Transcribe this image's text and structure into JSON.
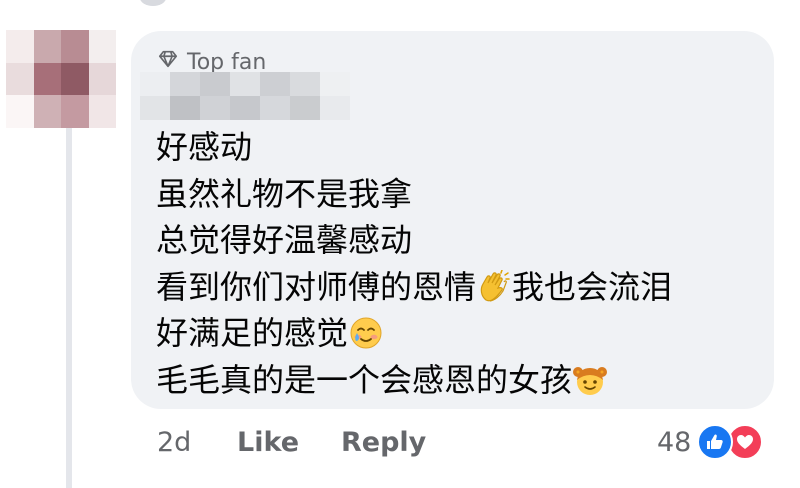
{
  "comment": {
    "badge_label": "Top fan",
    "badge_icon": "diamond-icon",
    "lines": [
      "好感动",
      "虽然礼物不是我拿",
      "总觉得好温馨感动",
      "看到你们对师傅的恩情",
      "我也会流泪",
      "好满足的感觉",
      "毛毛真的是一个会感恩的女孩"
    ],
    "emojis": [
      "clapping-hands-emoji",
      "smiling-face-with-tear-emoji",
      "girl-emoji"
    ]
  },
  "actions": {
    "time": "2d",
    "like_label": "Like",
    "reply_label": "Reply"
  },
  "reactions": {
    "count": "48",
    "icons": [
      "like-reaction-icon",
      "love-reaction-icon"
    ]
  },
  "colors": {
    "bubble": "#f0f2f5",
    "secondary_text": "#65676b",
    "like_blue": "#1877f2",
    "love_red": "#f33e58"
  }
}
